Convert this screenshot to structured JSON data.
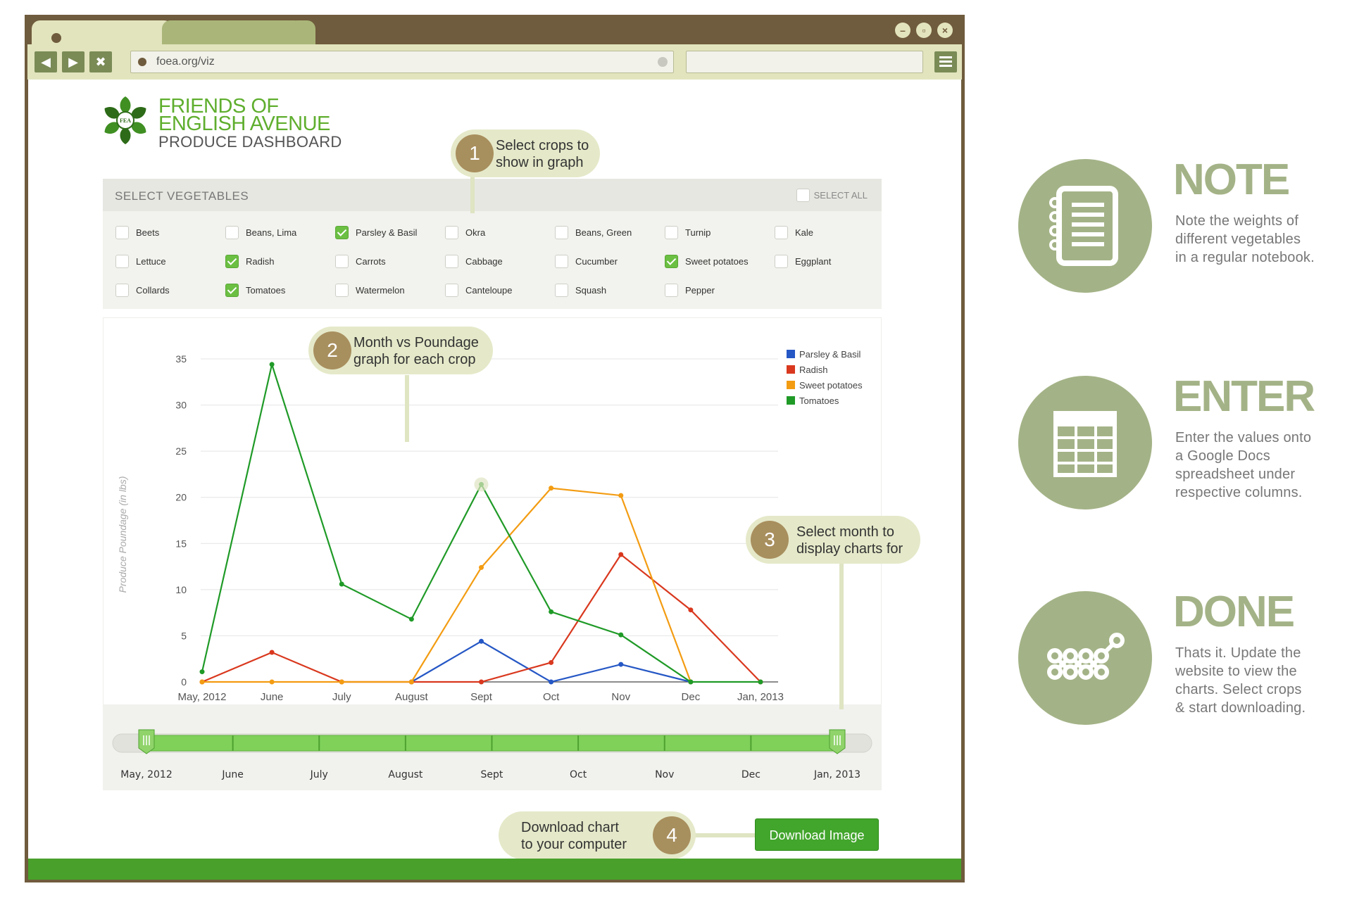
{
  "browser": {
    "url": "foea.org/viz",
    "search_value": "",
    "controls": [
      "minimize",
      "restore",
      "close"
    ]
  },
  "logo": {
    "line1": "FRIENDS OF",
    "line2": "ENGLISH AVENUE",
    "line3": "PRODUCE DASHBOARD",
    "emblem_text": "FEA"
  },
  "vegetables": {
    "title": "SELECT VEGETABLES",
    "select_all": "SELECT ALL",
    "items": [
      {
        "label": "Beets",
        "checked": false
      },
      {
        "label": "Beans, Lima",
        "checked": false
      },
      {
        "label": "Parsley & Basil",
        "checked": true
      },
      {
        "label": "Okra",
        "checked": false
      },
      {
        "label": "Beans, Green",
        "checked": false
      },
      {
        "label": "Turnip",
        "checked": false
      },
      {
        "label": "Kale",
        "checked": false
      },
      {
        "label": "Lettuce",
        "checked": false
      },
      {
        "label": "Radish",
        "checked": true
      },
      {
        "label": "Carrots",
        "checked": false
      },
      {
        "label": "Cabbage",
        "checked": false
      },
      {
        "label": "Cucumber",
        "checked": false
      },
      {
        "label": "Sweet potatoes",
        "checked": true
      },
      {
        "label": "Eggplant",
        "checked": false
      },
      {
        "label": "Collards",
        "checked": false
      },
      {
        "label": "Tomatoes",
        "checked": true
      },
      {
        "label": "Watermelon",
        "checked": false
      },
      {
        "label": "Canteloupe",
        "checked": false
      },
      {
        "label": "Squash",
        "checked": false
      },
      {
        "label": "Pepper",
        "checked": false
      }
    ]
  },
  "chart_data": {
    "type": "line",
    "ylabel": "Produce Poundage (in lbs)",
    "ylim": [
      0,
      35
    ],
    "yticks": [
      0,
      5,
      10,
      15,
      20,
      25,
      30,
      35
    ],
    "grid": true,
    "legend_position": "top-right",
    "categories": [
      "May, 2012",
      "June",
      "July",
      "August",
      "Sept",
      "Oct",
      "Nov",
      "Dec",
      "Jan, 2013"
    ],
    "series": [
      {
        "name": "Parsley & Basil",
        "color": "#2557c5",
        "values": [
          null,
          null,
          null,
          0,
          4.4,
          0,
          1.9,
          0,
          null
        ]
      },
      {
        "name": "Radish",
        "color": "#d9381e",
        "values": [
          0,
          3.2,
          0,
          0,
          0,
          2.1,
          13.8,
          7.8,
          0
        ]
      },
      {
        "name": "Sweet potatoes",
        "color": "#f39c12",
        "values": [
          0,
          0,
          0,
          0,
          12.4,
          21.0,
          20.2,
          0,
          null
        ]
      },
      {
        "name": "Tomatoes",
        "color": "#1f9a27",
        "values": [
          1.1,
          34.4,
          10.6,
          6.8,
          21.4,
          7.6,
          5.1,
          0,
          0
        ]
      }
    ]
  },
  "slider": {
    "labels": [
      "May, 2012",
      "June",
      "July",
      "August",
      "Sept",
      "Oct",
      "Nov",
      "Dec",
      "Jan, 2013"
    ],
    "range_start": "May, 2012",
    "range_end": "Jan, 2013"
  },
  "callouts": [
    {
      "num": "1",
      "line1": "Select crops to",
      "line2": "show in graph"
    },
    {
      "num": "2",
      "line1": "Month vs Poundage",
      "line2": "graph for each crop"
    },
    {
      "num": "3",
      "line1": "Select month to",
      "line2": "display charts for"
    },
    {
      "num": "4",
      "line1": "Download chart",
      "line2": "to your computer"
    }
  ],
  "download_button": "Download Image",
  "steps": [
    {
      "title": "NOTE",
      "icon": "notebook-icon",
      "lines": [
        "Note the weights of",
        "different vegetables",
        "in a regular notebook."
      ]
    },
    {
      "title": "ENTER",
      "icon": "spreadsheet-icon",
      "lines": [
        "Enter the values onto",
        "a Google Docs",
        "spreadsheet under",
        "respective columns."
      ]
    },
    {
      "title": "DONE",
      "icon": "line-chart-icon",
      "lines": [
        "Thats it. Update the",
        "website to view the",
        "charts. Select crops",
        "& start downloading."
      ]
    }
  ],
  "colors": {
    "brand_green": "#5fae2e",
    "frame_brown": "#6f5b3d",
    "sage": "#a4b387",
    "button_green": "#42a52c",
    "callout_badge": "#a88f5e"
  }
}
